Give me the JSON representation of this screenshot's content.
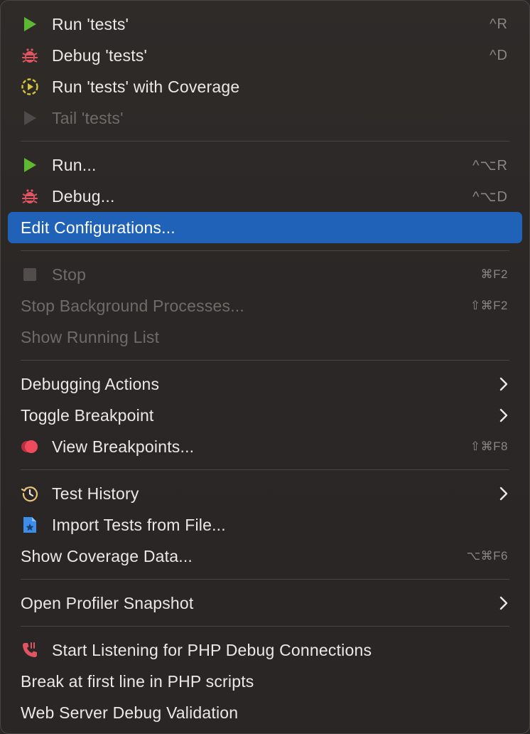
{
  "menu": {
    "items": [
      {
        "label": "Run 'tests'",
        "shortcut": "^R",
        "icon": "run-triangle-icon"
      },
      {
        "label": "Debug 'tests'",
        "shortcut": "^D",
        "icon": "bug-icon"
      },
      {
        "label": "Run 'tests' with Coverage",
        "shortcut": "",
        "icon": "coverage-icon"
      },
      {
        "label": "Tail 'tests'",
        "shortcut": "",
        "icon": "tail-triangle-icon"
      },
      {
        "label": "Run...",
        "shortcut": "^⌥R",
        "icon": "run-triangle-icon"
      },
      {
        "label": "Debug...",
        "shortcut": "^⌥D",
        "icon": "bug-icon"
      },
      {
        "label": "Edit Configurations...",
        "shortcut": ""
      },
      {
        "label": "Stop",
        "shortcut": "⌘F2",
        "icon": "stop-square-icon"
      },
      {
        "label": "Stop Background Processes...",
        "shortcut": "⇧⌘F2"
      },
      {
        "label": "Show Running List",
        "shortcut": ""
      },
      {
        "label": "Debugging Actions",
        "shortcut": ""
      },
      {
        "label": "Toggle Breakpoint",
        "shortcut": ""
      },
      {
        "label": "View Breakpoints...",
        "shortcut": "⇧⌘F8",
        "icon": "breakpoints-icon"
      },
      {
        "label": "Test History",
        "shortcut": "",
        "icon": "history-clock-icon"
      },
      {
        "label": "Import Tests from File...",
        "shortcut": "",
        "icon": "import-file-icon"
      },
      {
        "label": "Show Coverage Data...",
        "shortcut": "⌥⌘F6"
      },
      {
        "label": "Open Profiler Snapshot",
        "shortcut": ""
      },
      {
        "label": "Start Listening for PHP Debug Connections",
        "shortcut": "",
        "icon": "phone-listen-icon"
      },
      {
        "label": "Break at first line in PHP scripts",
        "shortcut": ""
      },
      {
        "label": "Web Server Debug Validation",
        "shortcut": ""
      }
    ],
    "colors": {
      "background": "#2b2726",
      "selection": "#1f62b8",
      "run_green": "#5fb832",
      "bug_red": "#e05561",
      "coverage_yellow": "#d9c53b",
      "breakpoint_red": "#ef4b5c",
      "import_blue": "#3d8ee8",
      "phone_red": "#e05561"
    }
  }
}
